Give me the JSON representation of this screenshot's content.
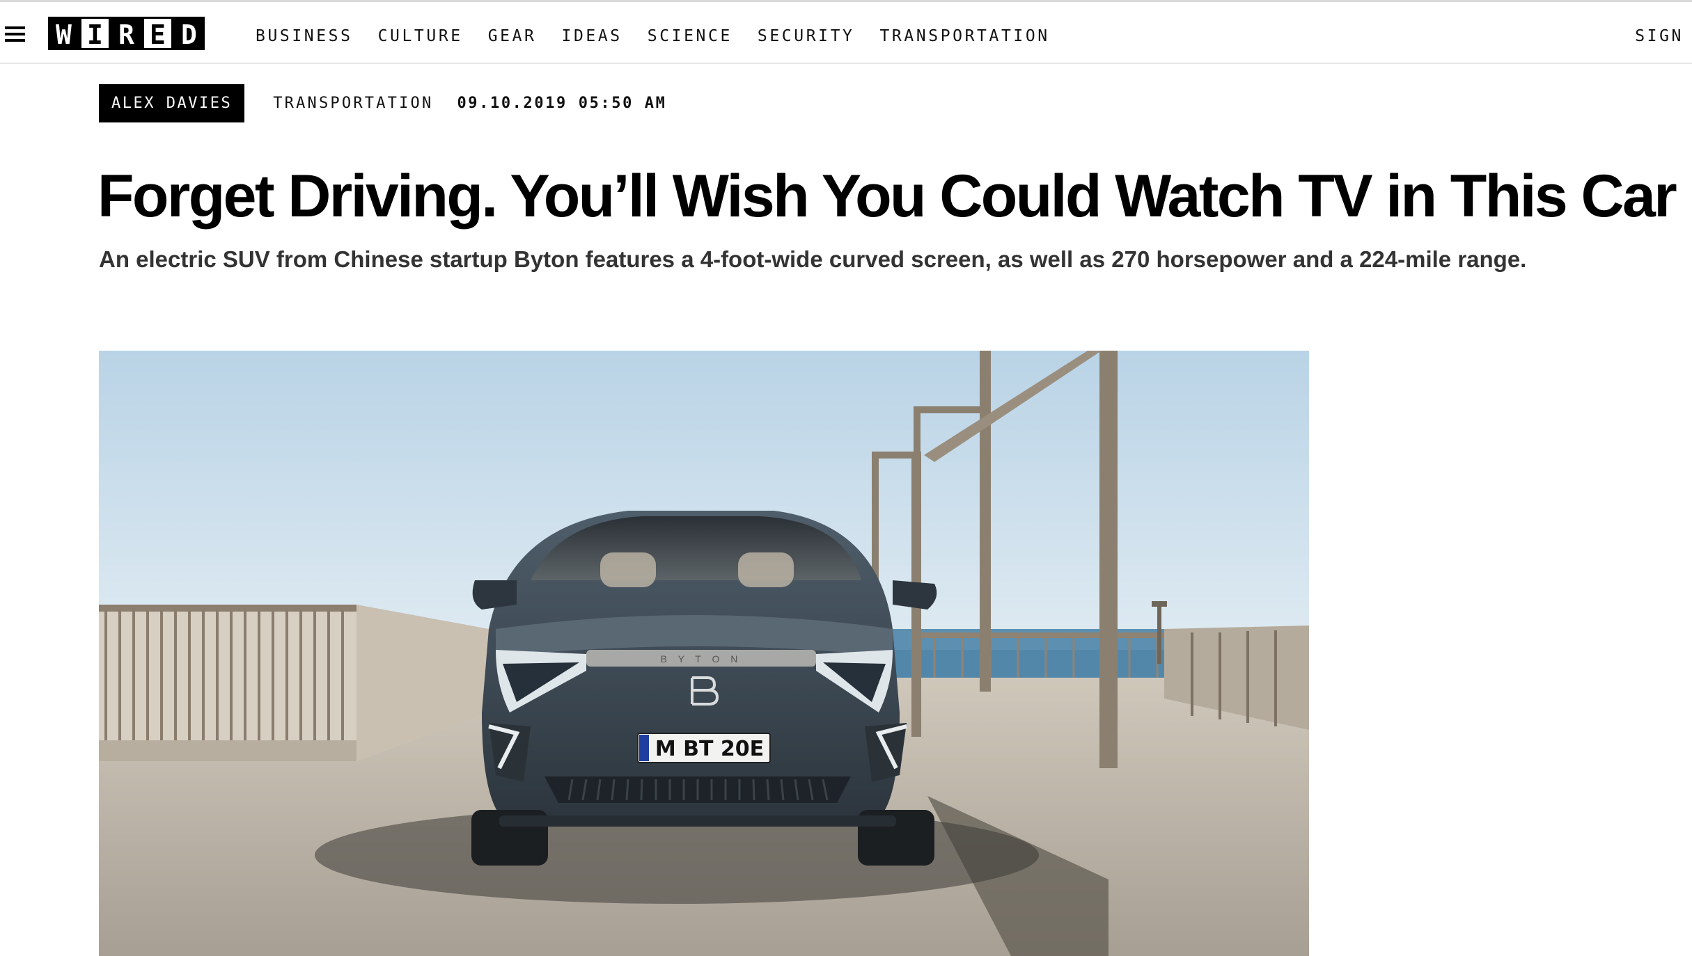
{
  "header": {
    "logo_letters": [
      "W",
      "I",
      "R",
      "E",
      "D"
    ],
    "nav": [
      "BUSINESS",
      "CULTURE",
      "GEAR",
      "IDEAS",
      "SCIENCE",
      "SECURITY",
      "TRANSPORTATION"
    ],
    "sign_in": "SIGN"
  },
  "article": {
    "author": "ALEX DAVIES",
    "category": "TRANSPORTATION",
    "date": "09.10.2019 05:50 AM",
    "headline": "Forget Driving. You’ll Wish You Could Watch TV in This Car",
    "dek": "An electric SUV from Chinese startup Byton features a 4-foot-wide curved screen, as well as 270 horsepower and a 224-mile range.",
    "image": {
      "car_brand_text": "B Y T O N",
      "license_plate": "M BT 20E"
    }
  },
  "colors": {
    "black": "#000000",
    "sky": "#c8dcea",
    "sea": "#5a8fb3",
    "car_body": "#3d4a55"
  },
  "icons": {
    "menu": "hamburger-icon"
  }
}
